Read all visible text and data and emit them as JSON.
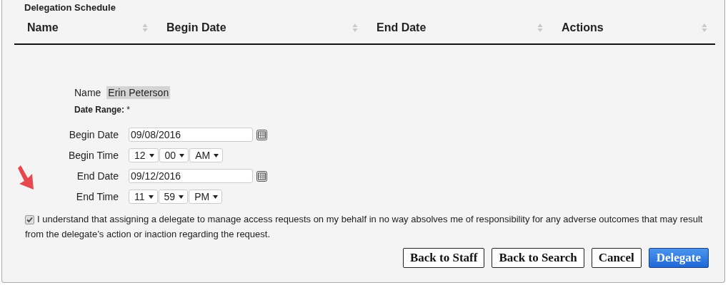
{
  "section_title": "Delegation Schedule",
  "table": {
    "columns": [
      "Name",
      "Begin Date",
      "End Date",
      "Actions"
    ]
  },
  "form": {
    "name_label": "Name",
    "name_value": "Erin Peterson",
    "range_label": "Date Range:",
    "range_required": "*",
    "rows": [
      {
        "kind": "date",
        "label": "Begin Date",
        "value": "09/08/2016"
      },
      {
        "kind": "time",
        "label": "Begin Time",
        "selects": [
          "12",
          "00",
          "AM"
        ]
      },
      {
        "kind": "date",
        "label": "End Date",
        "value": "09/12/2016"
      },
      {
        "kind": "time",
        "label": "End Time",
        "selects": [
          "11",
          "59",
          "PM"
        ]
      }
    ]
  },
  "agreement": {
    "checked": true,
    "text": "I understand that assigning a delegate to manage access requests on my behalf in no way absolves me of responsibility for any adverse outcomes that may result from the delegate’s action or inaction regarding the request."
  },
  "buttons": [
    {
      "label": "Back to Staff",
      "kind": "default"
    },
    {
      "label": "Back to Search",
      "kind": "default"
    },
    {
      "label": "Cancel",
      "kind": "default"
    },
    {
      "label": "Delegate",
      "kind": "primary"
    }
  ]
}
